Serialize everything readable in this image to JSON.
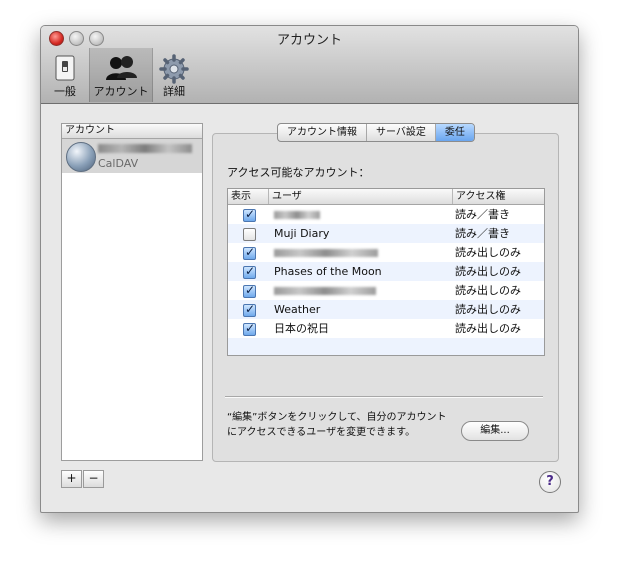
{
  "window": {
    "title": "アカウント"
  },
  "toolbar": {
    "items": [
      {
        "label": "一般",
        "icon": "switch-icon"
      },
      {
        "label": "アカウント",
        "icon": "people-icon",
        "selected": true
      },
      {
        "label": "詳細",
        "icon": "gear-icon"
      }
    ]
  },
  "sidebar": {
    "header": "アカウント",
    "accounts": [
      {
        "type": "CalDAV",
        "icon": "globe-icon"
      }
    ],
    "add_label": "+",
    "remove_label": "−"
  },
  "tabs": [
    {
      "label": "アカウント情報",
      "active": false
    },
    {
      "label": "サーバ設定",
      "active": false
    },
    {
      "label": "委任",
      "active": true
    }
  ],
  "delegation": {
    "accessible_label": "アクセス可能なアカウント：",
    "columns": {
      "show": "表示",
      "user": "ユーザ",
      "access": "アクセス権"
    },
    "rows": [
      {
        "checked": true,
        "user": "",
        "access": "読み／書き"
      },
      {
        "checked": false,
        "user": "Muji Diary",
        "access": "読み／書き"
      },
      {
        "checked": true,
        "user": "",
        "access": "読み出しのみ"
      },
      {
        "checked": true,
        "user": "Phases of the Moon",
        "access": "読み出しのみ"
      },
      {
        "checked": true,
        "user": "",
        "access": "読み出しのみ"
      },
      {
        "checked": true,
        "user": "Weather",
        "access": "読み出しのみ"
      },
      {
        "checked": true,
        "user": "日本の祝日",
        "access": "読み出しのみ"
      }
    ],
    "note_line1": "“編集”ボタンをクリックして、自分のアカウント",
    "note_line2": "にアクセスできるユーザを変更できます。",
    "edit_button": "編集..."
  },
  "help_label": "?",
  "colors": {
    "selected_tab": "#6aa5ef",
    "checkbox_on": "#6fa9ec",
    "row_alt": "#edf3fe",
    "close": "#d52a23"
  }
}
